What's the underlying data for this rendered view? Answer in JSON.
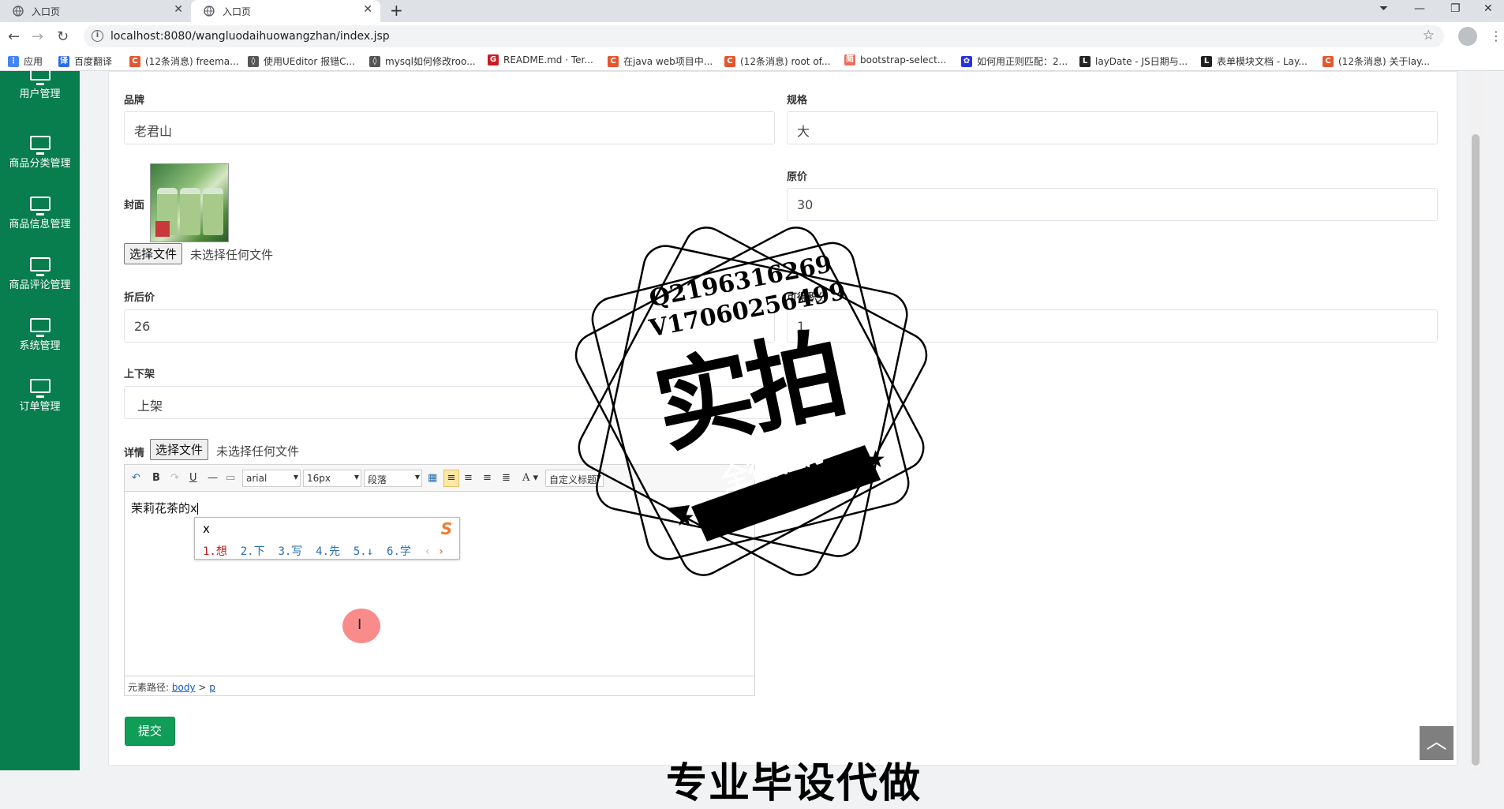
{
  "browser": {
    "tabs": [
      {
        "title": "入口页",
        "active": false
      },
      {
        "title": "入口页",
        "active": true
      }
    ],
    "url": "localhost:8080/wangluodaihuowangzhan/index.jsp",
    "bookmarks": [
      {
        "label": "应用",
        "icon": "apps-icon",
        "color": "#4285f4"
      },
      {
        "label": "百度翻译",
        "icon": "baidu-fanyi-icon",
        "color": "#2b6de9"
      },
      {
        "label": "(12条消息) freema...",
        "icon": "csdn-icon",
        "color": "#e4572e"
      },
      {
        "label": "使用UEditor 报错C...",
        "icon": "yuque-icon",
        "color": "#555555"
      },
      {
        "label": "mysql如何修改roo...",
        "icon": "yuque-icon",
        "color": "#555555"
      },
      {
        "label": "README.md · Ter...",
        "icon": "gitee-icon",
        "color": "#c71d23"
      },
      {
        "label": "在java web项目中...",
        "icon": "csdn-icon",
        "color": "#e4572e"
      },
      {
        "label": "(12条消息) root of...",
        "icon": "csdn-icon",
        "color": "#e4572e"
      },
      {
        "label": "bootstrap-select...",
        "icon": "jianshu-icon",
        "color": "#ea6f5a"
      },
      {
        "label": "如何用正则匹配：2...",
        "icon": "baidu-icon",
        "color": "#2932e1"
      },
      {
        "label": "layDate - JS日期与...",
        "icon": "layui-icon",
        "color": "#222222"
      },
      {
        "label": "表单模块文档 - Lay...",
        "icon": "layui-icon",
        "color": "#222222"
      },
      {
        "label": "(12条消息) 关于lay...",
        "icon": "csdn-icon",
        "color": "#e4572e"
      }
    ]
  },
  "sidebar": {
    "items": [
      {
        "label": "用户管理"
      },
      {
        "label": "商品分类管理"
      },
      {
        "label": "商品信息管理"
      },
      {
        "label": "商品评论管理"
      },
      {
        "label": "系统管理"
      },
      {
        "label": "订单管理"
      }
    ]
  },
  "form": {
    "brand_label": "品牌",
    "brand_value": "老君山",
    "spec_label": "规格",
    "spec_value": "大",
    "cover_label": "封面",
    "price_label": "原价",
    "price_value": "30",
    "discount_label": "折后价",
    "discount_value": "26",
    "points_label": "可得积分",
    "points_value": "1",
    "shelf_label": "上下架",
    "shelf_value": "上架",
    "detail_label": "详情",
    "file_button": "选择文件",
    "file_note": "未选择任何文件",
    "submit_label": "提交"
  },
  "editor": {
    "font_family": "arial",
    "font_size": "16px",
    "paragraph": "段落",
    "custom_title": "自定义标题",
    "content": "茉莉花茶的x",
    "path_label": "元素路径:",
    "path_body": "body",
    "path_sep": ">",
    "path_p": "p"
  },
  "ime": {
    "input": "x",
    "candidates": [
      "1.想",
      "2.下",
      "3.写",
      "4.先",
      "5.↓",
      "6.学"
    ],
    "logo": "S"
  },
  "watermark": {
    "line1": "Q2196316269",
    "line2": "V17060256499",
    "main": "实拍",
    "ribbon": "全微程序",
    "bottom": "专业毕设代做"
  },
  "colors": {
    "sidebar": "#087d4e",
    "submit": "#0f9d58"
  }
}
